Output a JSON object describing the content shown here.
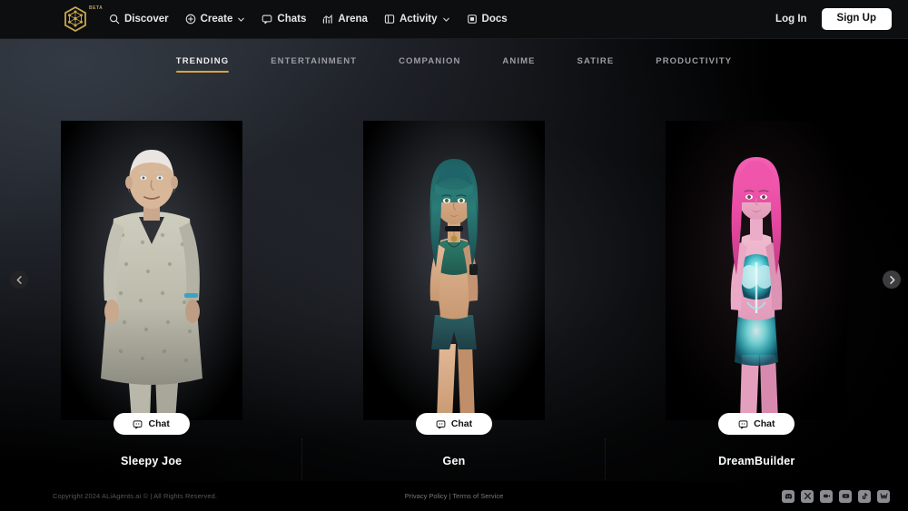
{
  "header": {
    "logo": {
      "name": "aliagents-hex-logo",
      "badge": "BETA",
      "color": "#c9a84c"
    },
    "nav": [
      {
        "label": "Discover",
        "icon": "search-icon",
        "caret": false
      },
      {
        "label": "Create",
        "icon": "plus-circle-icon",
        "caret": true
      },
      {
        "label": "Chats",
        "icon": "chat-bubble-icon",
        "caret": false
      },
      {
        "label": "Arena",
        "icon": "chart-up-icon",
        "caret": false
      },
      {
        "label": "Activity",
        "icon": "panel-icon",
        "caret": true
      },
      {
        "label": "Docs",
        "icon": "document-icon",
        "caret": false
      }
    ],
    "login_label": "Log In",
    "signup_label": "Sign Up"
  },
  "tabs": [
    {
      "label": "TRENDING",
      "active": true
    },
    {
      "label": "ENTERTAINMENT",
      "active": false
    },
    {
      "label": "COMPANION",
      "active": false
    },
    {
      "label": "ANIME",
      "active": false
    },
    {
      "label": "SATIRE",
      "active": false
    },
    {
      "label": "PRODUCTIVITY",
      "active": false
    }
  ],
  "carousel": {
    "prev_icon": "chevron-left-icon",
    "next_icon": "chevron-right-icon",
    "chat_label": "Chat",
    "chat_icon": "chat-bubble-icon",
    "cards": [
      {
        "name": "Sleepy Joe",
        "theme": "elderly-man-hospital-gown"
      },
      {
        "name": "Gen",
        "theme": "teal-haired-woman"
      },
      {
        "name": "DreamBuilder",
        "theme": "pink-haired-woman-glow-suit"
      }
    ]
  },
  "footer": {
    "copyright": "Copyright 2024 ALiAgents.ai © | All Rights Reserved.",
    "privacy_label": "Privacy Policy",
    "separator": "|",
    "terms_label": "Terms of Service",
    "socials": [
      {
        "name": "discord-icon"
      },
      {
        "name": "x-twitter-icon"
      },
      {
        "name": "video-camera-icon"
      },
      {
        "name": "youtube-icon"
      },
      {
        "name": "tiktok-icon"
      },
      {
        "name": "warpcast-icon"
      }
    ]
  },
  "colors": {
    "accent_gold": "#d9a441",
    "background": "#000000",
    "header_bg": "#0d0e10"
  }
}
